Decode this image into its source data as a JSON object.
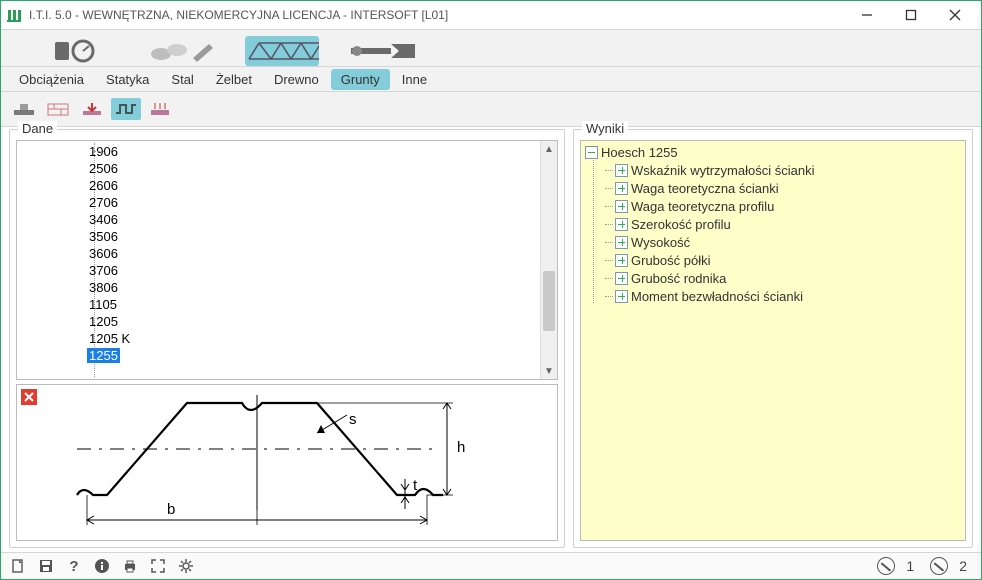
{
  "title": "I.T.I. 5.0 - WEWNĘTRZNA, NIEKOMERCYJNA LICENCJA - INTERSOFT [L01]",
  "tabs": [
    "Obciążenia",
    "Statyka",
    "Stal",
    "Żelbet",
    "Drewno",
    "Grunty",
    "Inne"
  ],
  "tabs_selected": "Grunty",
  "dane_label": "Dane",
  "wyniki_label": "Wyniki",
  "list": [
    "1906",
    "2506",
    "2606",
    "2706",
    "3406",
    "3506",
    "3606",
    "3706",
    "3806",
    "1105",
    "1205",
    "1205 K",
    "1255"
  ],
  "list_selected": "1255",
  "diagram_labels": {
    "s": "s",
    "h": "h",
    "t": "t",
    "b": "b"
  },
  "results": {
    "root": "Hoesch 1255",
    "children": [
      "Wskaźnik wytrzymałości ścianki",
      "Waga teoretyczna ścianki",
      "Waga teoretyczna profilu",
      "Szerokość profilu",
      "Wysokość",
      "Grubość półki",
      "Grubość rodnika",
      "Moment bezwładności ścianki"
    ]
  },
  "status_nums": [
    "1",
    "2"
  ]
}
